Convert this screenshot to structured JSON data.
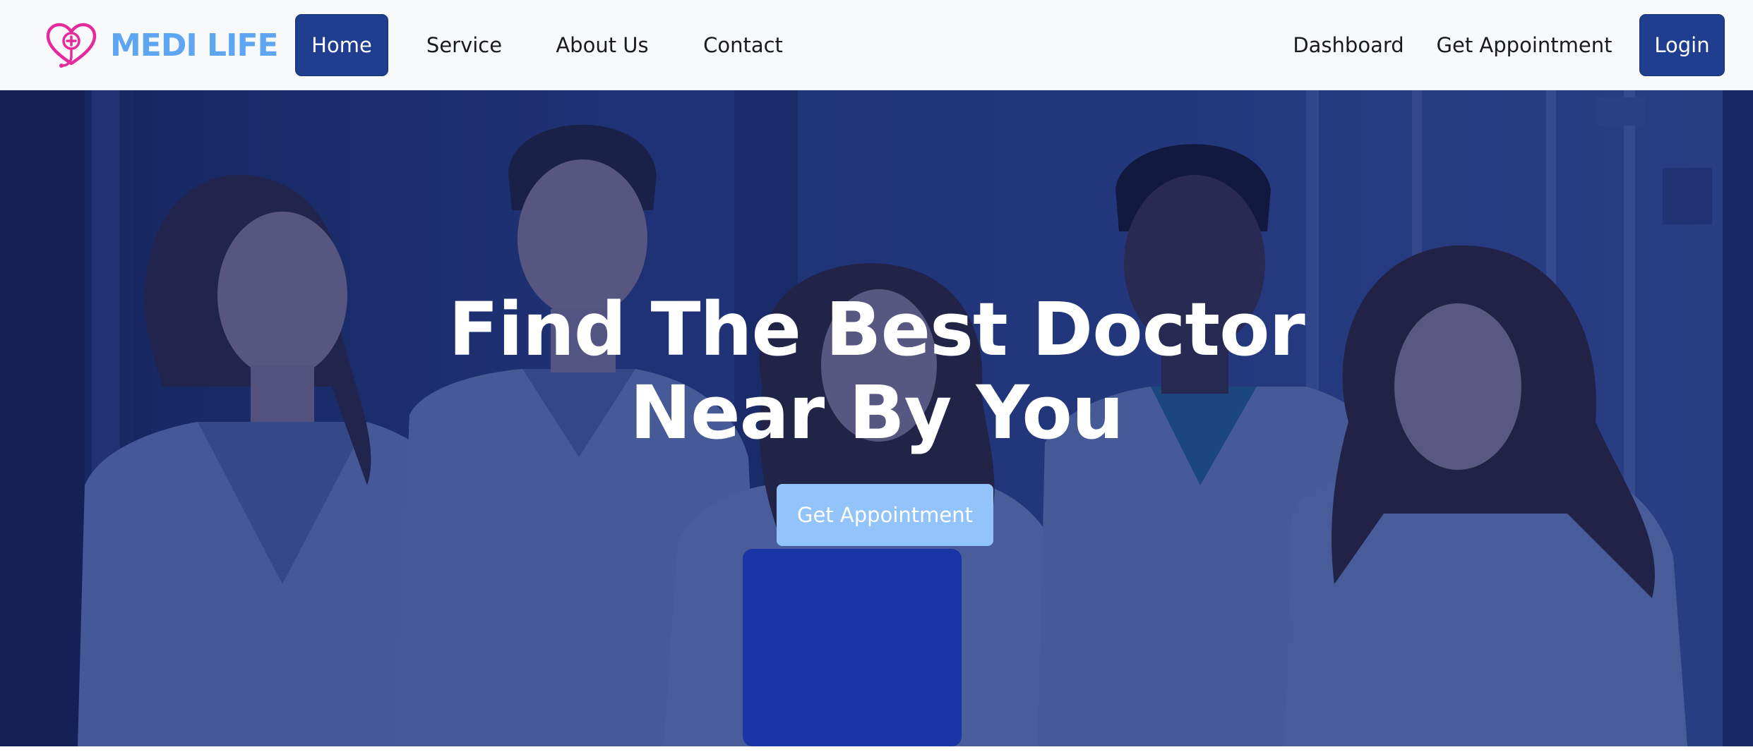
{
  "brand": {
    "name": "MEDI LIFE",
    "logo_icon": "heart-stethoscope-icon",
    "logo_color": "#e52b9b",
    "name_color": "#5ea6f2"
  },
  "nav": {
    "left_links": [
      {
        "label": "Home",
        "active": true
      },
      {
        "label": "Service",
        "active": false
      },
      {
        "label": "About Us",
        "active": false
      },
      {
        "label": "Contact",
        "active": false
      }
    ],
    "right_links": [
      {
        "label": "Dashboard"
      },
      {
        "label": "Get Appointment"
      }
    ],
    "login_label": "Login",
    "active_color": "#1f3e8f"
  },
  "hero": {
    "title_line1": "Find The Best Doctor",
    "title_line2": "Near By You",
    "cta_label": "Get Appointment",
    "cta_color": "#93c3fb",
    "overlay_color": "#172a70",
    "background_image": "group-of-doctors-photo"
  }
}
